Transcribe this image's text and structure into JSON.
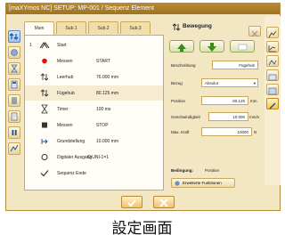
{
  "window": {
    "title": "[maXYmos NC] SETUP: MP-001 / Sequenz Element"
  },
  "tabs": [
    "Main",
    "Sub.1",
    "Sub.2",
    "Sub.3"
  ],
  "left_toolbar": [
    "sequence-icon",
    "drop-icon",
    "hourglass-icon",
    "calculator-icon",
    "list-icon",
    "document-icon",
    "pause-icon",
    "graph-icon"
  ],
  "sequence": [
    {
      "num": "1",
      "icon": "start-icon",
      "name": "Start",
      "value": ""
    },
    {
      "num": "",
      "icon": "dot-icon",
      "name": "Messen",
      "value": "START"
    },
    {
      "num": "",
      "icon": "updown-icon",
      "name": "Leerhub",
      "value": "76.000 mm"
    },
    {
      "num": "",
      "icon": "updown-icon",
      "name": "Fügehub",
      "value": "80.125 mm"
    },
    {
      "num": "",
      "icon": "hourglass-icon",
      "name": "Timer",
      "value": "100 ms"
    },
    {
      "num": "",
      "icon": "square-icon",
      "name": "Messen",
      "value": "STOP"
    },
    {
      "num": "",
      "icon": "home-icon",
      "name": "Grundstellung",
      "value": "10.000 mm"
    },
    {
      "num": "",
      "icon": "ring-icon",
      "name": "Digitaler Ausgang",
      "value": "O:UNI-1=1"
    },
    {
      "num": "",
      "icon": "check-icon",
      "name": "Sequenz Ende",
      "value": ""
    }
  ],
  "panel": {
    "title": "Bewegung",
    "fields": [
      {
        "label": "Beschreibung",
        "value": "Fügehub",
        "unit": ""
      },
      {
        "label": "Bezug",
        "value": "Absolut",
        "unit": ""
      },
      {
        "label": "Position",
        "value": "80.125",
        "unit": "mm"
      },
      {
        "label": "Geschwindigkeit",
        "value": "10.000",
        "unit": "mm/s"
      },
      {
        "label": "Max. Kraft",
        "value": "10000",
        "unit": "N"
      }
    ],
    "bedingung_label": "Bedingung:",
    "bedingung_value": "Position",
    "extended_button": "Erweiterte Funktionen"
  },
  "right_toolbar": [
    "chart-icon-1",
    "chart-icon-2",
    "chart-icon-3",
    "chart-icon-4",
    "chart-icon-5",
    "edit-icon"
  ],
  "caption": "設定画面",
  "colors": {
    "accent": "#b98a33",
    "background": "#f3e6c2",
    "selected_row": "#f6ecd2",
    "ok_green": "#3d8c1e"
  }
}
